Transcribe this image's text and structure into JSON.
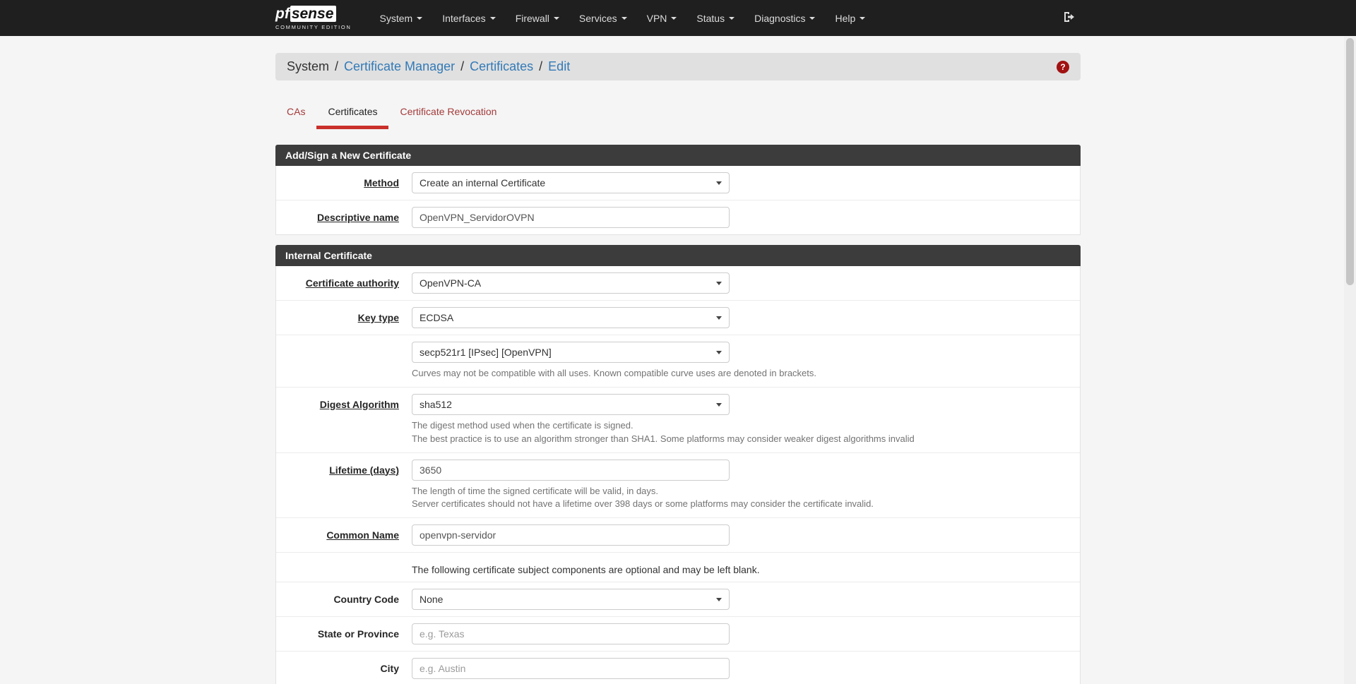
{
  "colors": {
    "navbar_bg": "#1f1f1f",
    "panel_header_bg": "#3c3c3c",
    "accent_red": "#c9302c",
    "link_blue": "#337ab7",
    "breadcrumb_bg": "#e0e0e0"
  },
  "icons": {
    "logout": "sign-out-icon",
    "help": "question-circle-icon",
    "menu_caret": "caret-down-icon",
    "select_arrow": "chevron-down-icon"
  },
  "navbar": {
    "logo": {
      "pf": "pf",
      "sense": "sense",
      "edition": "COMMUNITY EDITION"
    },
    "items": [
      {
        "label": "System"
      },
      {
        "label": "Interfaces"
      },
      {
        "label": "Firewall"
      },
      {
        "label": "Services"
      },
      {
        "label": "VPN"
      },
      {
        "label": "Status"
      },
      {
        "label": "Diagnostics"
      },
      {
        "label": "Help"
      }
    ]
  },
  "breadcrumb": {
    "separator": "/",
    "help_icon": "?",
    "items": [
      {
        "label": "System"
      },
      {
        "label": "Certificate Manager"
      },
      {
        "label": "Certificates"
      },
      {
        "label": "Edit"
      }
    ]
  },
  "tabs": {
    "items": [
      {
        "label": "CAs"
      },
      {
        "label": "Certificates",
        "active": true
      },
      {
        "label": "Certificate Revocation"
      }
    ]
  },
  "sections": [
    {
      "title": "Add/Sign a New Certificate",
      "rows": [
        {
          "label": "Method",
          "control": "select",
          "value": "Create an internal Certificate"
        },
        {
          "label": "Descriptive name",
          "control": "text",
          "value": "OpenVPN_ServidorOVPN"
        }
      ]
    },
    {
      "title": "Internal Certificate",
      "rows": [
        {
          "label": "Certificate authority",
          "control": "select",
          "value": "OpenVPN-CA"
        },
        {
          "label": "Key type",
          "control": "select",
          "value": "ECDSA"
        },
        {
          "label": "",
          "control": "select",
          "value": "secp521r1 [IPsec] [OpenVPN]",
          "help": [
            "Curves may not be compatible with all uses. Known compatible curve uses are denoted in brackets."
          ]
        },
        {
          "label": "Digest Algorithm",
          "control": "select",
          "value": "sha512",
          "help": [
            "The digest method used when the certificate is signed.",
            "The best practice is to use an algorithm stronger than SHA1. Some platforms may consider weaker digest algorithms invalid"
          ]
        },
        {
          "label": "Lifetime (days)",
          "control": "text",
          "value": "3650",
          "help": [
            "The length of time the signed certificate will be valid, in days.",
            "Server certificates should not have a lifetime over 398 days or some platforms may consider the certificate invalid."
          ]
        },
        {
          "label": "Common Name",
          "control": "text",
          "value": "openvpn-servidor"
        },
        {
          "note": "The following certificate subject components are optional and may be left blank."
        },
        {
          "label": "Country Code",
          "control": "select",
          "value": "None"
        },
        {
          "label": "State or Province",
          "control": "text",
          "placeholder": "e.g. Texas"
        },
        {
          "label": "City",
          "control": "text",
          "placeholder": "e.g. Austin"
        }
      ]
    }
  ]
}
